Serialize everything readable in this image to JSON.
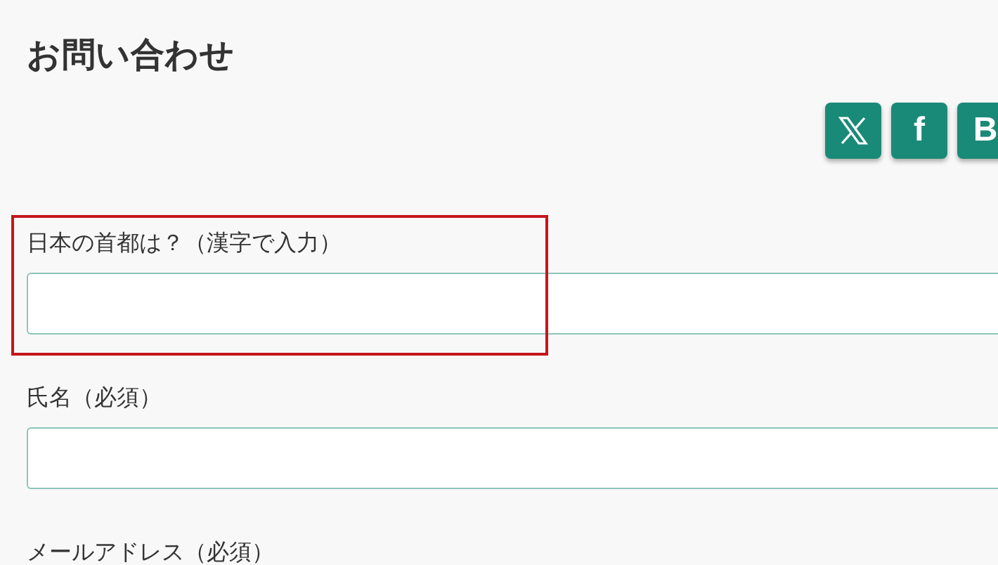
{
  "title": "お問い合わせ",
  "share_buttons": [
    {
      "kind": "x"
    },
    {
      "kind": "letter",
      "label": "f"
    },
    {
      "kind": "letter",
      "label": "B"
    }
  ],
  "fields": [
    {
      "kind": "input",
      "label": "日本の首都は？（漢字で入力）",
      "highlighted": true
    },
    {
      "kind": "input",
      "label": "氏名（必須）",
      "highlighted": false
    },
    {
      "kind": "label",
      "label": "メールアドレス（必須）",
      "highlighted": false
    }
  ]
}
